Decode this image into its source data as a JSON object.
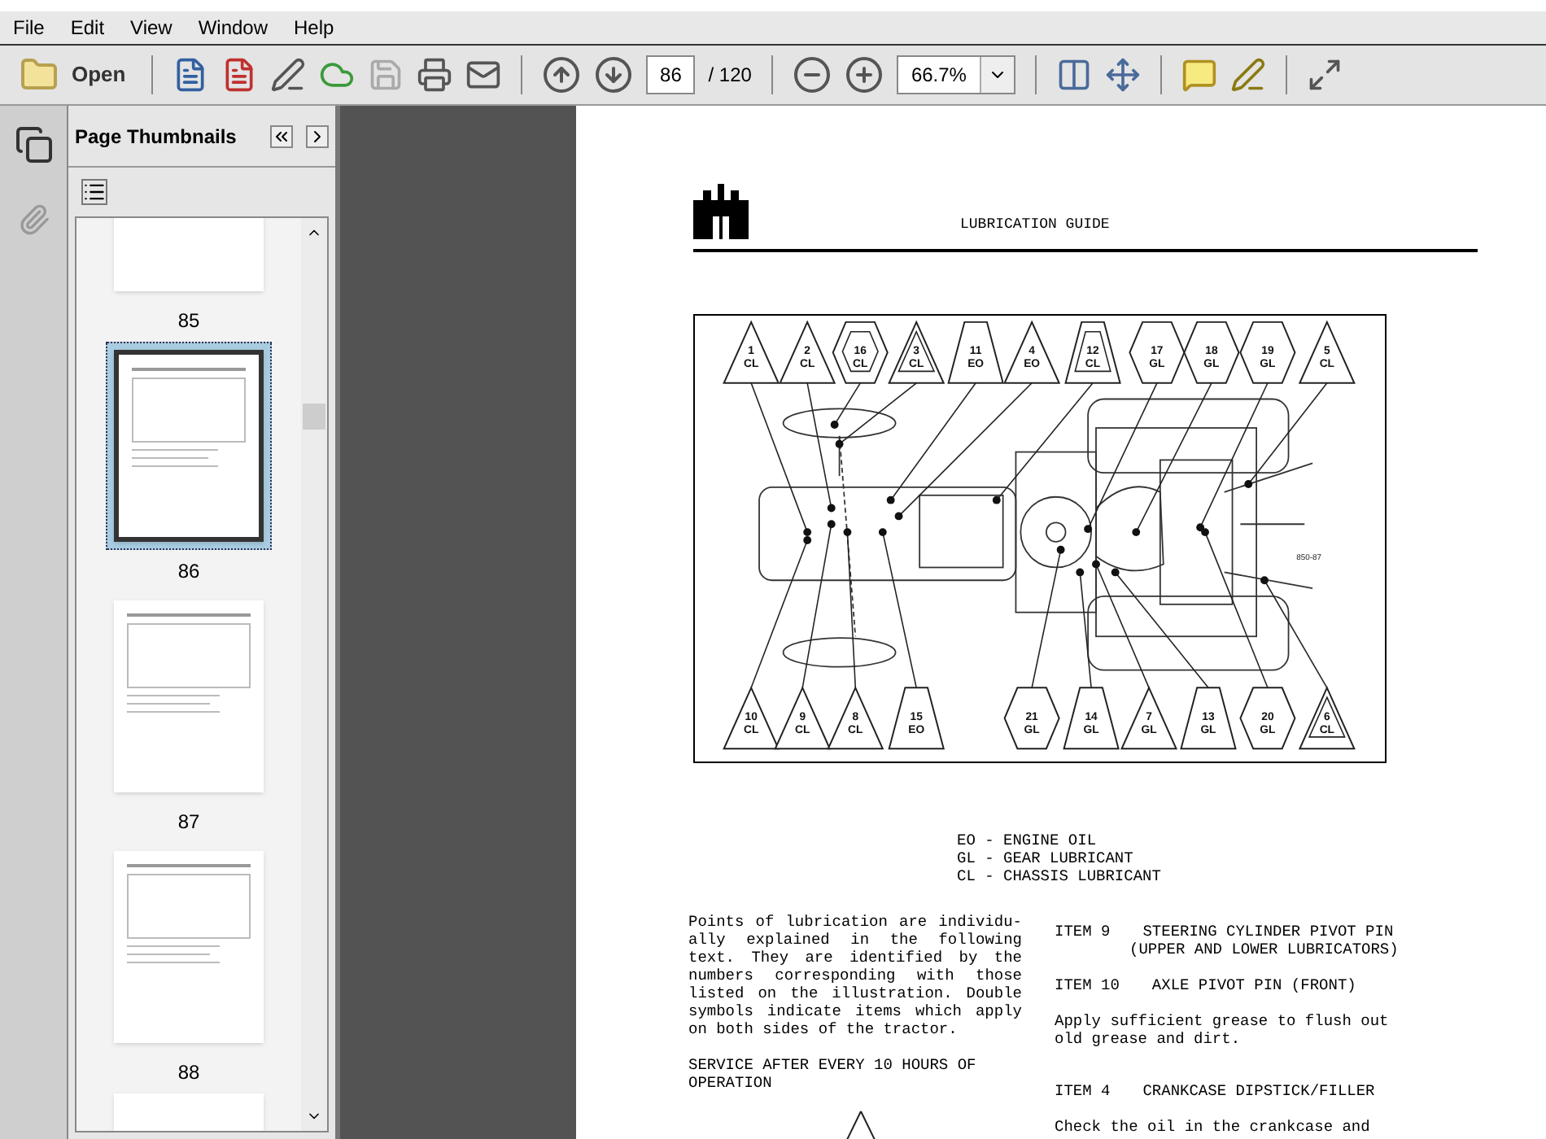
{
  "menu": [
    "File",
    "Edit",
    "View",
    "Window",
    "Help"
  ],
  "toolbar": {
    "open_label": "Open",
    "page_number": "86",
    "page_total": "/ 120",
    "zoom": "66.7%"
  },
  "sidebar": {
    "title": "Page Thumbnails",
    "pages": [
      {
        "label": "85",
        "selected": false
      },
      {
        "label": "86",
        "selected": true
      },
      {
        "label": "87",
        "selected": false
      },
      {
        "label": "88",
        "selected": false
      }
    ]
  },
  "document": {
    "header": "LUBRICATION GUIDE",
    "figure_code": "850-87",
    "markers_top": [
      {
        "number": "1",
        "code": "CL",
        "kind": "triangle",
        "double": false
      },
      {
        "number": "2",
        "code": "CL",
        "kind": "triangle",
        "double": false
      },
      {
        "number": "16",
        "code": "CL",
        "kind": "hexagon",
        "double": true
      },
      {
        "number": "3",
        "code": "CL",
        "kind": "triangle",
        "double": true
      },
      {
        "number": "11",
        "code": "EO",
        "kind": "trapezoid",
        "double": false
      },
      {
        "number": "4",
        "code": "EO",
        "kind": "triangle",
        "double": false
      },
      {
        "number": "12",
        "code": "CL",
        "kind": "trapezoid",
        "double": true
      },
      {
        "number": "17",
        "code": "GL",
        "kind": "hexagon",
        "double": false
      },
      {
        "number": "18",
        "code": "GL",
        "kind": "hexagon",
        "double": false
      },
      {
        "number": "19",
        "code": "GL",
        "kind": "hexagon",
        "double": false
      },
      {
        "number": "5",
        "code": "CL",
        "kind": "triangle",
        "double": false
      }
    ],
    "markers_bottom": [
      {
        "number": "10",
        "code": "CL",
        "kind": "triangle",
        "double": false
      },
      {
        "number": "9",
        "code": "CL",
        "kind": "triangle",
        "double": false
      },
      {
        "number": "8",
        "code": "CL",
        "kind": "triangle",
        "double": false
      },
      {
        "number": "15",
        "code": "EO",
        "kind": "trapezoid",
        "double": false
      },
      {
        "number": "21",
        "code": "GL",
        "kind": "hexagon",
        "double": false
      },
      {
        "number": "14",
        "code": "GL",
        "kind": "trapezoid",
        "double": false
      },
      {
        "number": "7",
        "code": "GL",
        "kind": "triangle",
        "double": false
      },
      {
        "number": "13",
        "code": "GL",
        "kind": "trapezoid",
        "double": false
      },
      {
        "number": "20",
        "code": "GL",
        "kind": "hexagon",
        "double": false
      },
      {
        "number": "6",
        "code": "CL",
        "kind": "triangle",
        "double": true
      }
    ],
    "legend": [
      "EO - ENGINE OIL",
      "GL - GEAR LUBRICANT",
      "CL - CHASSIS LUBRICANT"
    ],
    "intro": "Points of lubrication are individu- ally explained in the following text.  They are identified by the numbers corresponding with those listed on the illustration.  Double symbols indicate items which apply on both sides of the tractor.",
    "service_heading": "SERVICE AFTER EVERY 10 HOURS OF OPERATION",
    "items": [
      {
        "kind": "heading",
        "label": "ITEM 9",
        "text": "STEERING CYLINDER PIVOT PIN",
        "sub": "(UPPER AND LOWER LUBRICATORS)"
      },
      {
        "kind": "heading",
        "label": "ITEM 10",
        "text": "AXLE PIVOT PIN (FRONT)"
      },
      {
        "kind": "paragraph",
        "text": "Apply sufficient grease to flush out old grease and dirt."
      },
      {
        "kind": "heading",
        "label": "ITEM 4",
        "text": "CRANKCASE DIPSTICK/FILLER"
      },
      {
        "kind": "paragraph",
        "text": "Check the oil in the crankcase and"
      }
    ]
  }
}
